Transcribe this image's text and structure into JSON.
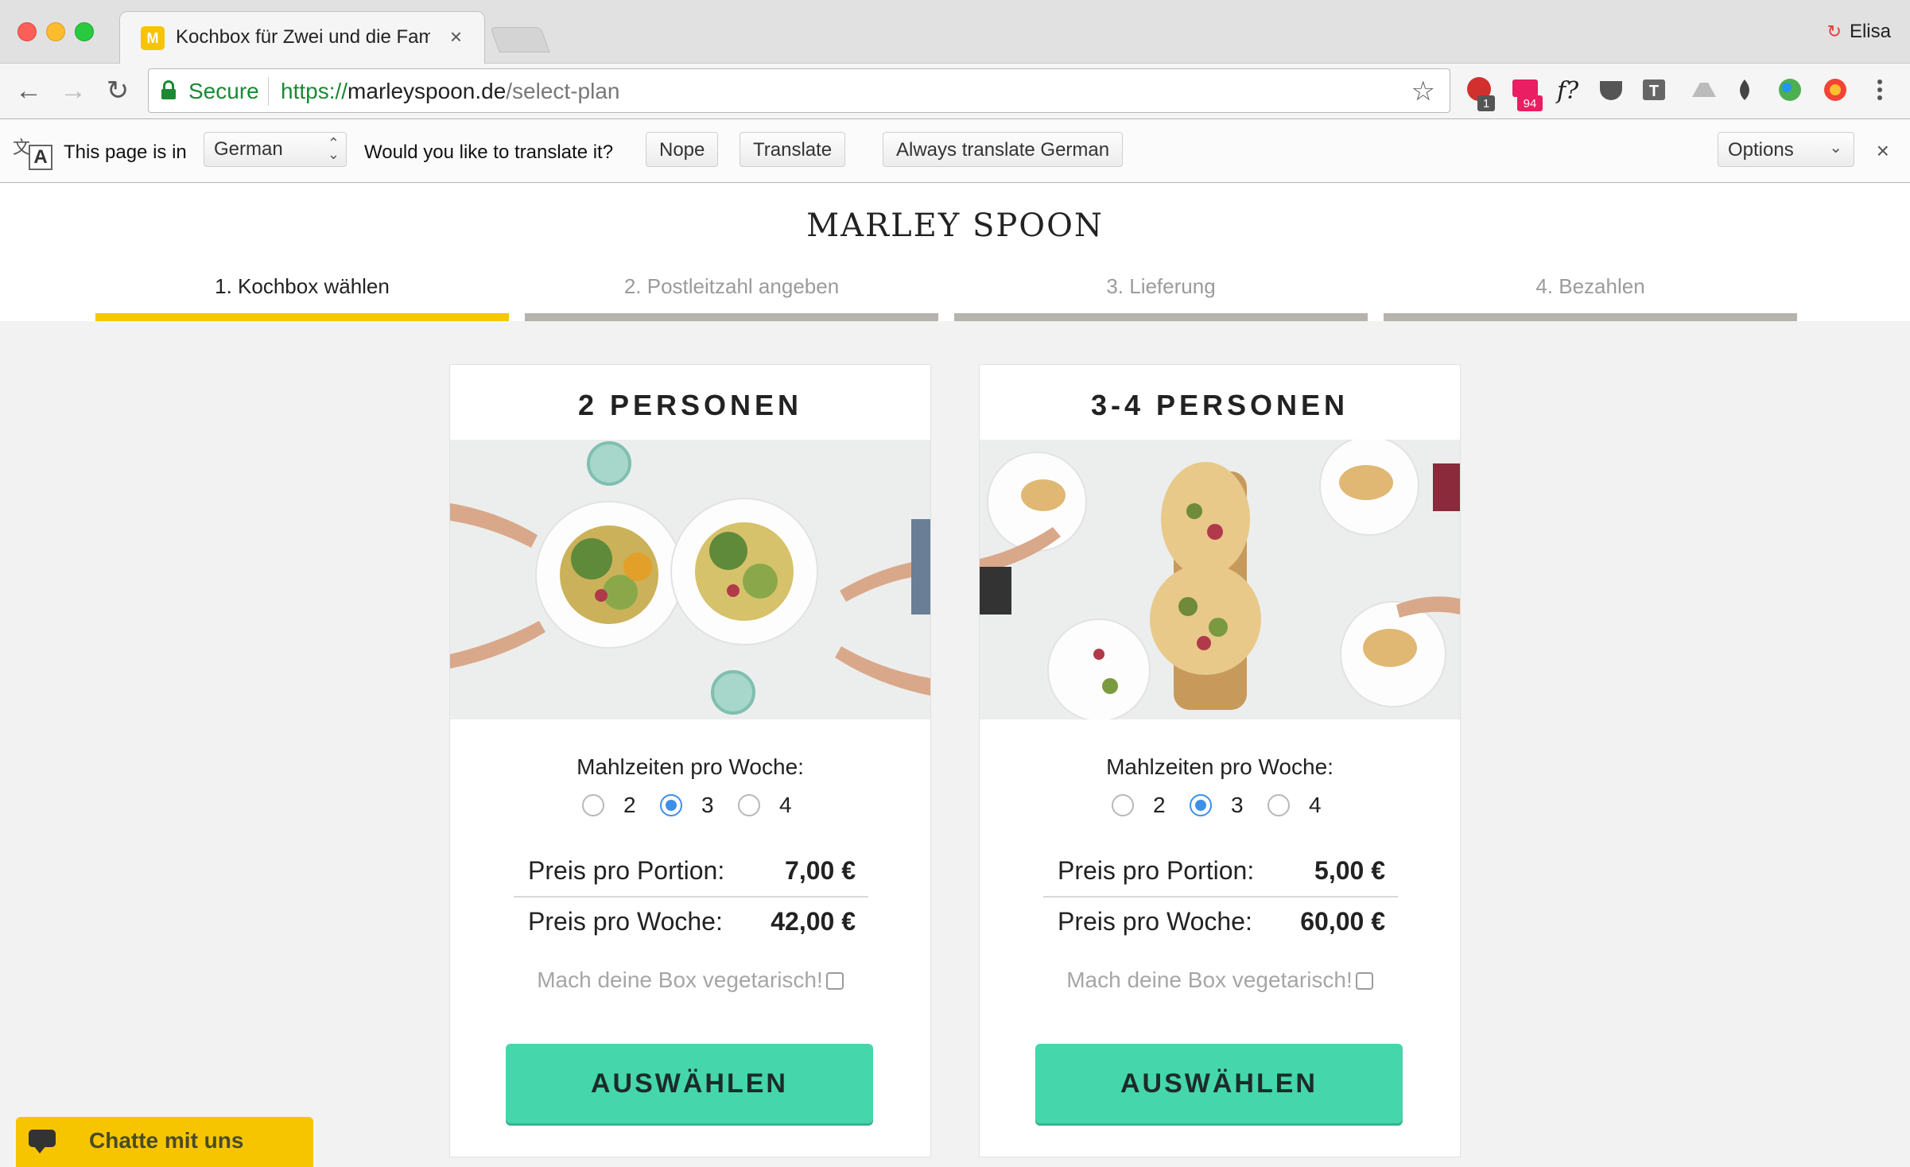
{
  "browser": {
    "tab_title": "Kochbox für Zwei und die Fami",
    "profile_name": "Elisa",
    "secure_label": "Secure",
    "url_scheme": "https://",
    "url_host": "marleyspoon.de",
    "url_path": "/select-plan",
    "extension_badges": [
      "1",
      "94"
    ]
  },
  "translate_bar": {
    "page_in_label": "This page is in",
    "language": "German",
    "question": "Would you like to translate it?",
    "nope_label": "Nope",
    "translate_label": "Translate",
    "always_label": "Always translate German",
    "options_label": "Options"
  },
  "site": {
    "logo": "MARLEY SPOON",
    "steps": [
      {
        "label": "1. Kochbox wählen",
        "active": true
      },
      {
        "label": "2. Postleitzahl angeben",
        "active": false
      },
      {
        "label": "3. Lieferung",
        "active": false
      },
      {
        "label": "4. Bezahlen",
        "active": false
      }
    ]
  },
  "plans": [
    {
      "title": "2 PERSONEN",
      "meals_label": "Mahlzeiten pro Woche:",
      "meal_options": [
        "2",
        "3",
        "4"
      ],
      "selected_meals": "3",
      "portion_label": "Preis pro Portion:",
      "portion_price": "7,00 €",
      "week_label": "Preis pro Woche:",
      "week_price": "42,00 €",
      "veg_label": "Mach deine Box vegetarisch!",
      "button_label": "AUSWÄHLEN"
    },
    {
      "title": "3-4 PERSONEN",
      "meals_label": "Mahlzeiten pro Woche:",
      "meal_options": [
        "2",
        "3",
        "4"
      ],
      "selected_meals": "3",
      "portion_label": "Preis pro Portion:",
      "portion_price": "5,00 €",
      "week_label": "Preis pro Woche:",
      "week_price": "60,00 €",
      "veg_label": "Mach deine Box vegetarisch!",
      "button_label": "AUSWÄHLEN"
    }
  ],
  "chat": {
    "label": "Chatte mit uns"
  },
  "colors": {
    "accent_yellow": "#f5c800",
    "button_green": "#45d6ac",
    "secure_green": "#1a8a34",
    "radio_blue": "#3e8fe8"
  }
}
